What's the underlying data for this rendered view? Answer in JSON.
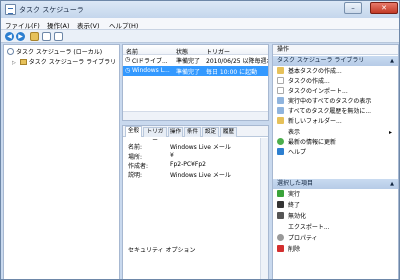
{
  "window": {
    "title": "タスク スケジューラ",
    "close_glyph": "✕",
    "min_glyph": "–",
    "max_glyph": "□"
  },
  "menu": {
    "file": "ファイル(F)",
    "action": "操作(A)",
    "view": "表示(V)",
    "help": "ヘルプ(H)"
  },
  "tree": {
    "root": "タスク スケジューラ (ローカル)",
    "library": "タスク スケジューラ ライブラリ"
  },
  "task_list": {
    "columns": [
      "名前",
      "状態",
      "トリガー"
    ],
    "rows": [
      {
        "name": "CIドライブ...",
        "status": "準備完了",
        "trigger": "2010/06/25 以降毎週水"
      },
      {
        "name": "Windows L...",
        "status": "準備完了",
        "trigger": "毎日 10:00 に起動"
      }
    ]
  },
  "details": {
    "tabs": [
      "全般",
      "トリガー",
      "操作",
      "条件",
      "設定",
      "履歴"
    ],
    "name_label": "名前:",
    "name_value": "Windows Live メール",
    "location_label": "場所:",
    "location_value": "¥",
    "author_label": "作成者:",
    "author_value": "Fp2-PC¥Fp2",
    "description_label": "説明:",
    "description_value": "Windows Live メール",
    "security_label": "セキュリティ オプション"
  },
  "actions": {
    "header": "操作",
    "section1": "タスク スケジューラ ライブラリ",
    "items1": [
      "基本タスクの作成...",
      "タスクの作成...",
      "タスクのインポート...",
      "実行中のすべてのタスクの表示",
      "すべてのタスク履歴を無効に...",
      "新しいフォルダー...",
      "表示",
      "最新の情報に更新",
      "ヘルプ"
    ],
    "section2": "選択した項目",
    "items2": [
      "実行",
      "終了",
      "無効化",
      "エクスポート...",
      "プロパティ",
      "削除"
    ]
  }
}
